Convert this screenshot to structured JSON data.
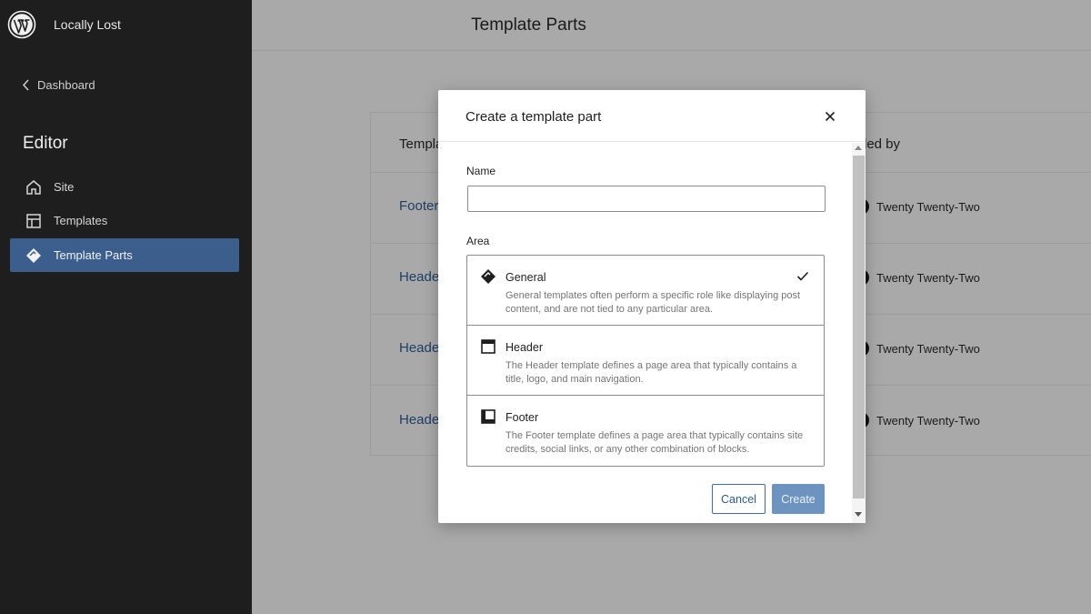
{
  "sidebar": {
    "site_name": "Locally Lost",
    "back_label": "Dashboard",
    "section_heading": "Editor",
    "items": [
      {
        "label": "Site",
        "icon": "home-icon"
      },
      {
        "label": "Templates",
        "icon": "layout-icon"
      },
      {
        "label": "Template Parts",
        "icon": "symbol-icon",
        "active": true
      }
    ]
  },
  "main": {
    "page_title": "Template Parts",
    "table": {
      "col_template": "Templa",
      "col_added_by": "led by",
      "rows": [
        {
          "name": "Footer",
          "added_by": "Twenty Twenty-Two"
        },
        {
          "name": "Heade",
          "added_by": "Twenty Twenty-Two"
        },
        {
          "name": "Heade",
          "added_by": "Twenty Twenty-Two"
        },
        {
          "name": "Heade",
          "added_by": "Twenty Twenty-Two"
        }
      ]
    }
  },
  "modal": {
    "title": "Create a template part",
    "name_label": "Name",
    "name_value": "",
    "area_label": "Area",
    "areas": [
      {
        "title": "General",
        "description": "General templates often perform a specific role like displaying post content, and are not tied to any particular area.",
        "selected": true,
        "icon": "symbol-icon"
      },
      {
        "title": "Header",
        "description": "The Header template defines a page area that typically contains a title, logo, and main navigation.",
        "selected": false,
        "icon": "header-icon"
      },
      {
        "title": "Footer",
        "description": "The Footer template defines a page area that typically contains site credits, social links, or any other combination of blocks.",
        "selected": false,
        "icon": "footer-icon"
      }
    ],
    "cancel_label": "Cancel",
    "create_label": "Create"
  },
  "colors": {
    "sidebar_bg": "#1e1e1e",
    "active_item": "#3b5e8c",
    "overlay": "#a9a9a9",
    "primary": "#3b6ea5"
  }
}
